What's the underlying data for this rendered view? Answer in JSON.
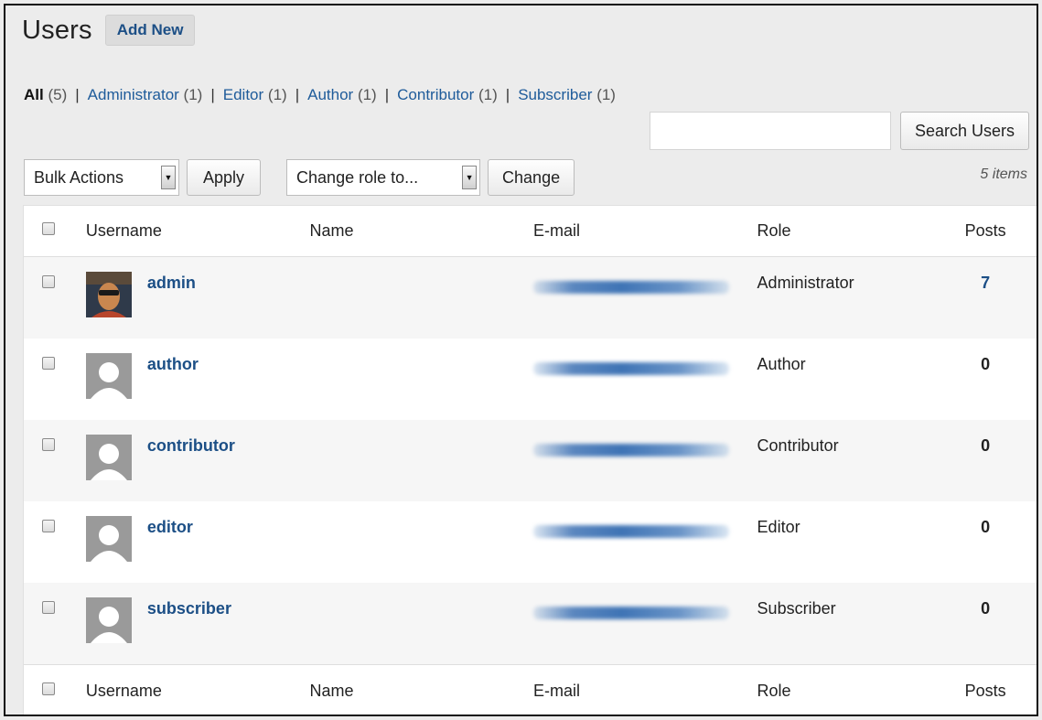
{
  "header": {
    "title": "Users",
    "add_new_label": "Add New"
  },
  "filters": [
    {
      "label": "All",
      "count": "(5)",
      "current": true
    },
    {
      "label": "Administrator",
      "count": "(1)",
      "current": false
    },
    {
      "label": "Editor",
      "count": "(1)",
      "current": false
    },
    {
      "label": "Author",
      "count": "(1)",
      "current": false
    },
    {
      "label": "Contributor",
      "count": "(1)",
      "current": false
    },
    {
      "label": "Subscriber",
      "count": "(1)",
      "current": false
    }
  ],
  "search": {
    "value": "",
    "placeholder": "",
    "button_label": "Search Users"
  },
  "tablenav": {
    "bulk_actions": "Bulk Actions",
    "apply_label": "Apply",
    "change_role": "Change role to...",
    "change_label": "Change",
    "items_count": "5 items"
  },
  "table": {
    "columns": [
      "Username",
      "Name",
      "E-mail",
      "Role",
      "Posts"
    ],
    "rows": [
      {
        "username": "admin",
        "name": "",
        "role": "Administrator",
        "posts": "7",
        "avatar": "photo"
      },
      {
        "username": "author",
        "name": "",
        "role": "Author",
        "posts": "0",
        "avatar": "default"
      },
      {
        "username": "contributor",
        "name": "",
        "role": "Contributor",
        "posts": "0",
        "avatar": "default"
      },
      {
        "username": "editor",
        "name": "",
        "role": "Editor",
        "posts": "0",
        "avatar": "default"
      },
      {
        "username": "subscriber",
        "name": "",
        "role": "Subscriber",
        "posts": "0",
        "avatar": "default"
      }
    ]
  },
  "colors": {
    "link": "#1c4f86",
    "background": "#ececec",
    "alt_row": "#f6f6f6"
  }
}
